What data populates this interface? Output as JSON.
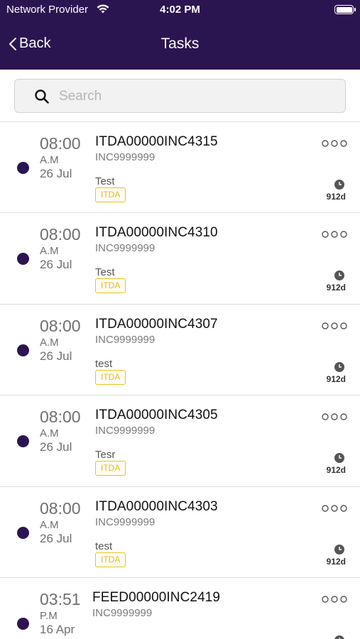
{
  "status_bar": {
    "carrier": "Network Provider",
    "time": "4:02 PM"
  },
  "nav": {
    "back_label": "Back",
    "title": "Tasks"
  },
  "search": {
    "placeholder": "Search",
    "value": ""
  },
  "colors": {
    "header_bg": "#2b1551",
    "dot": "#2b1551",
    "tag_border": "#e9c21f"
  },
  "tasks": [
    {
      "time": "08:00",
      "ampm": "A.M",
      "date": "26 Jul",
      "id": "ITDA00000INC4315",
      "inc": "INC9999999",
      "desc": "Test",
      "tag": "ITDA",
      "age": "912d"
    },
    {
      "time": "08:00",
      "ampm": "A.M",
      "date": "26 Jul",
      "id": "ITDA00000INC4310",
      "inc": "INC9999999",
      "desc": "Test",
      "tag": "ITDA",
      "age": "912d"
    },
    {
      "time": "08:00",
      "ampm": "A.M",
      "date": "26 Jul",
      "id": "ITDA00000INC4307",
      "inc": "INC9999999",
      "desc": "test",
      "tag": "ITDA",
      "age": "912d"
    },
    {
      "time": "08:00",
      "ampm": "A.M",
      "date": "26 Jul",
      "id": "ITDA00000INC4305",
      "inc": "INC9999999",
      "desc": "Tesr",
      "tag": "ITDA",
      "age": "912d"
    },
    {
      "time": "08:00",
      "ampm": "A.M",
      "date": "26 Jul",
      "id": "ITDA00000INC4303",
      "inc": "INC9999999",
      "desc": "test",
      "tag": "ITDA",
      "age": "912d"
    },
    {
      "time": "03:51",
      "ampm": "P.M",
      "date": "16 Apr",
      "id": "FEED00000INC2419",
      "inc": "INC9999999"
    }
  ]
}
